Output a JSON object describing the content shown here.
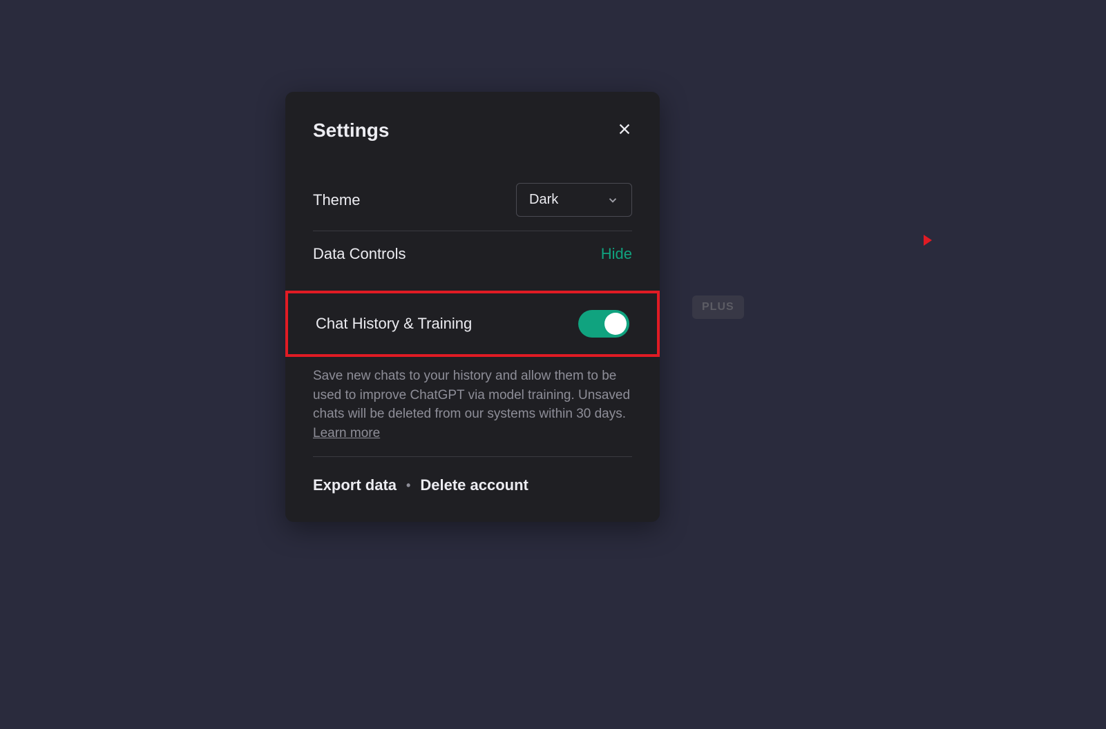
{
  "modal": {
    "title": "Settings",
    "theme": {
      "label": "Theme",
      "selected": "Dark"
    },
    "dataControls": {
      "label": "Data Controls",
      "toggleLink": "Hide"
    },
    "chatHistory": {
      "label": "Chat History & Training",
      "enabled": true,
      "descriptionPart1": "Save new chats to your history and allow them to be used to improve ChatGPT via model training. Unsaved chats will be deleted from our systems within 30 days. ",
      "learnMore": "Learn more"
    },
    "footer": {
      "export": "Export data",
      "delete": "Delete account"
    }
  },
  "badge": {
    "plus": "PLUS"
  }
}
